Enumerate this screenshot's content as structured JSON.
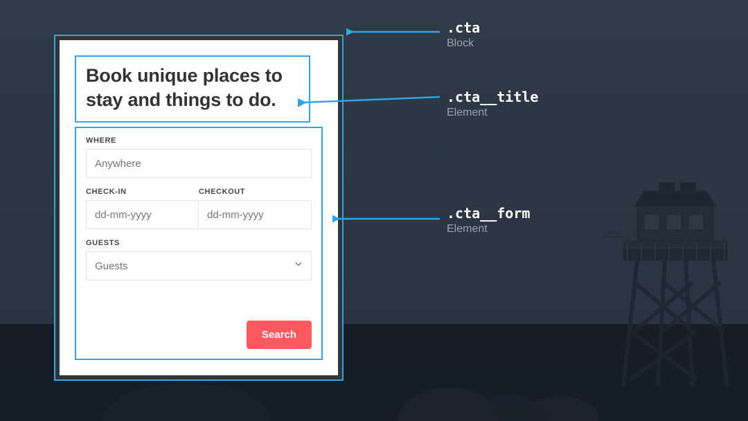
{
  "card": {
    "title": "Book unique places to stay and things to do.",
    "form": {
      "where_label": "WHERE",
      "where_placeholder": "Anywhere",
      "checkin_label": "CHECK-IN",
      "checkin_placeholder": "dd-mm-yyyy",
      "checkout_label": "CHECKOUT",
      "checkout_placeholder": "dd-mm-yyyy",
      "guests_label": "GUESTS",
      "guests_placeholder": "Guests",
      "search_label": "Search"
    }
  },
  "annotations": {
    "cta": {
      "selector": ".cta",
      "role": "Block"
    },
    "title": {
      "selector": ".cta__title",
      "role": "Element"
    },
    "form": {
      "selector": ".cta__form",
      "role": "Element"
    }
  },
  "colors": {
    "outline": "#2fa6e8",
    "button": "#ff5a5f",
    "bg": "#2a3440"
  }
}
